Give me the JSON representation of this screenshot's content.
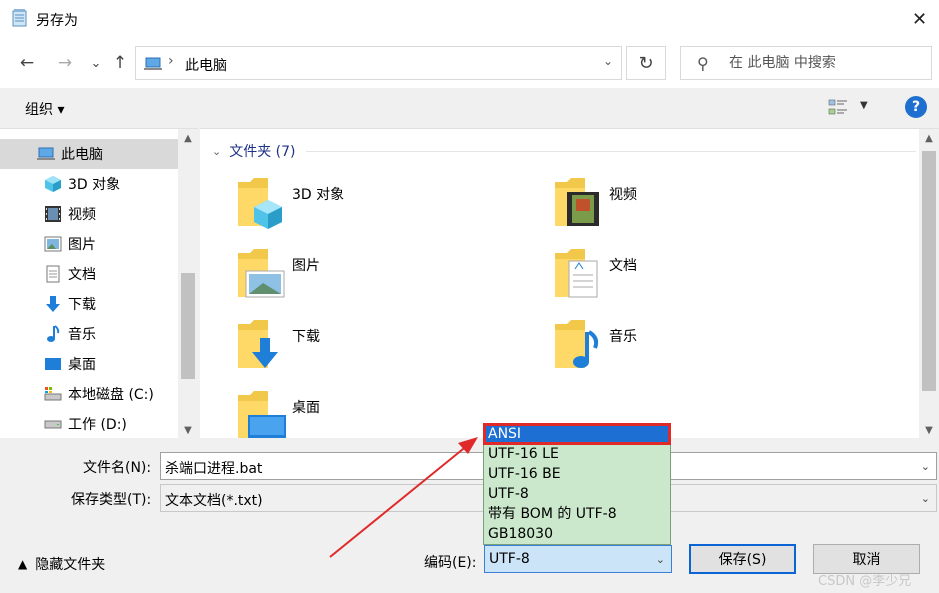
{
  "window": {
    "title": "另存为",
    "close_glyph": "✕"
  },
  "nav": {
    "back_glyph": "←",
    "forward_glyph": "→",
    "recent_glyph": "⌄",
    "up_glyph": "↑",
    "breadcrumb_sep": "›",
    "location": "此电脑",
    "address_dropdown": "⌄",
    "refresh_glyph": "↻",
    "search_icon_glyph": "⚲",
    "search_placeholder": "在 此电脑 中搜索"
  },
  "toolbar": {
    "organize_label": "组织 ▾",
    "view_dropdown": "▼",
    "help_label": "?"
  },
  "sidebar": {
    "items": [
      {
        "label": "此电脑",
        "icon": "computer-icon"
      },
      {
        "label": "3D 对象",
        "icon": "3d-objects-icon"
      },
      {
        "label": "视频",
        "icon": "video-icon"
      },
      {
        "label": "图片",
        "icon": "pictures-icon"
      },
      {
        "label": "文档",
        "icon": "documents-icon"
      },
      {
        "label": "下载",
        "icon": "downloads-icon"
      },
      {
        "label": "音乐",
        "icon": "music-icon"
      },
      {
        "label": "桌面",
        "icon": "desktop-icon"
      },
      {
        "label": "本地磁盘 (C:)",
        "icon": "drive-c-icon"
      },
      {
        "label": "工作 (D:)",
        "icon": "drive-d-icon"
      }
    ],
    "scroll_up": "▲",
    "scroll_down": "▼"
  },
  "content": {
    "group_chevron": "⌄",
    "group_title": "文件夹 (7)",
    "folders": [
      {
        "name": "3D 对象",
        "icon": "3d-objects-folder-icon"
      },
      {
        "name": "视频",
        "icon": "video-folder-icon"
      },
      {
        "name": "图片",
        "icon": "pictures-folder-icon"
      },
      {
        "name": "文档",
        "icon": "documents-folder-icon"
      },
      {
        "name": "下载",
        "icon": "downloads-folder-icon"
      },
      {
        "name": "音乐",
        "icon": "music-folder-icon"
      },
      {
        "name": "桌面",
        "icon": "desktop-folder-icon"
      }
    ],
    "scroll_up": "▲",
    "scroll_down": "▼"
  },
  "form": {
    "filename_label": "文件名(N):",
    "filename_value": "杀端口进程.bat",
    "filetype_label": "保存类型(T):",
    "filetype_value": "文本文档(*.txt)",
    "combo_arrow": "⌄",
    "hide_folders_caret": "▲",
    "hide_folders_label": "隐藏文件夹",
    "encoding_label": "编码(E):",
    "encoding_value": "UTF-8",
    "save_button": "保存(S)",
    "cancel_button": "取消"
  },
  "encoding_options": [
    "ANSI",
    "UTF-16 LE",
    "UTF-16 BE",
    "UTF-8",
    "带有 BOM 的 UTF-8",
    "GB18030"
  ],
  "selected_option": "ANSI",
  "watermark": "CSDN @李少兄",
  "colors": {
    "accent": "#1d6fd3",
    "highlight_border": "#e02a2a",
    "dropdown_bg": "#cbe8cc",
    "arrow": "#e02a2a"
  }
}
